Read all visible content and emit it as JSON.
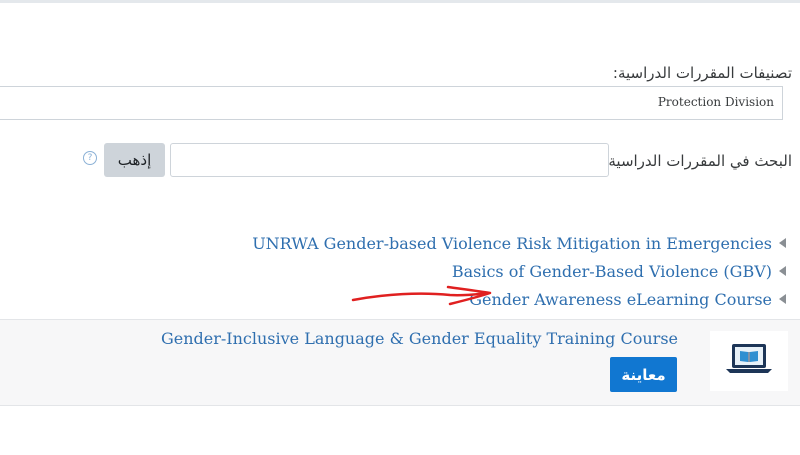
{
  "categories": {
    "label": "تصنيفات المقررات الدراسية:",
    "selected": "Protection Division"
  },
  "search": {
    "label": "البحث في المقررات الدراسية",
    "value": "",
    "go_label": "إذهب",
    "help_glyph": "?"
  },
  "courses": [
    {
      "title": "UNRWA Gender-based Violence Risk Mitigation in Emergencies"
    },
    {
      "title": "Basics of Gender-Based Violence (GBV)"
    },
    {
      "title": "Gender Awareness eLearning Course"
    }
  ],
  "featured_course": {
    "title": "Gender-Inclusive Language & Gender Equality Training Course",
    "preview_label": "معاينة",
    "image_icon": "laptop-book-icon"
  },
  "annotation": {
    "arrow_color": "#e02020"
  }
}
